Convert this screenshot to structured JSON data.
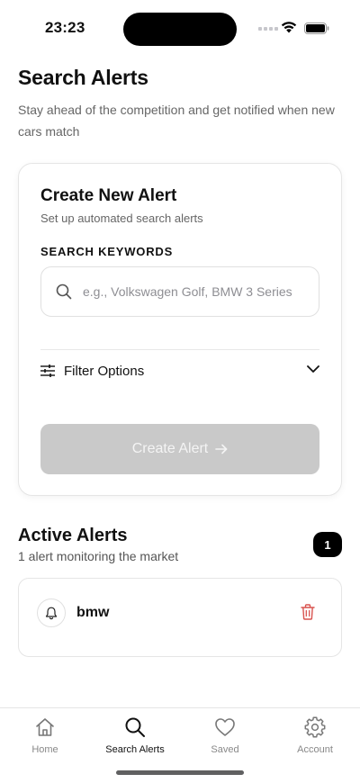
{
  "status_bar": {
    "time": "23:23"
  },
  "header": {
    "title": "Search Alerts",
    "subtitle": "Stay ahead of the competition and get notified when new cars match"
  },
  "create_card": {
    "title": "Create New Alert",
    "subtitle": "Set up automated search alerts",
    "keywords_label": "SEARCH KEYWORDS",
    "search_placeholder": "e.g., Volkswagen Golf, BMW 3 Series",
    "search_value": "",
    "filter_label": "Filter Options",
    "create_button_label": "Create Alert",
    "create_button_enabled": false
  },
  "active_alerts": {
    "title": "Active Alerts",
    "subtitle": "1 alert monitoring the market",
    "count": "1",
    "items": [
      {
        "name": "bmw",
        "icon": "bell-icon",
        "action_icon": "trash-icon"
      }
    ]
  },
  "tab_bar": {
    "tabs": [
      {
        "label": "Home",
        "icon": "home-icon",
        "active": false
      },
      {
        "label": "Search Alerts",
        "icon": "search-icon",
        "active": true
      },
      {
        "label": "Saved",
        "icon": "heart-icon",
        "active": false
      },
      {
        "label": "Account",
        "icon": "gear-icon",
        "active": false
      }
    ]
  },
  "colors": {
    "text_primary": "#111111",
    "text_secondary": "#666666",
    "button_disabled_bg": "#c9c9c9",
    "badge_bg": "#000000",
    "trash_red": "#d9534f",
    "tab_inactive": "#888888"
  }
}
